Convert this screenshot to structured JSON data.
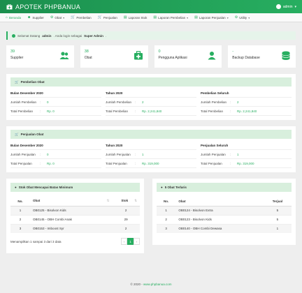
{
  "app": {
    "title": "APOTEK PHPBANUA",
    "user": "admin"
  },
  "nav": [
    {
      "icon": "home-icon",
      "glyph": "⌂",
      "label": "Beranda",
      "active": true,
      "caret": false
    },
    {
      "icon": "users-icon",
      "glyph": "☻",
      "label": "Supplier",
      "caret": false
    },
    {
      "icon": "gear-icon",
      "glyph": "⚙",
      "label": "Obat",
      "caret": true
    },
    {
      "icon": "cart-icon",
      "glyph": "🛒",
      "label": "Pembelian",
      "caret": false
    },
    {
      "icon": "cart-icon",
      "glyph": "🛒",
      "label": "Penjualan",
      "caret": false
    },
    {
      "icon": "file-icon",
      "glyph": "▤",
      "label": "Laporan Stok",
      "caret": false
    },
    {
      "icon": "file-icon",
      "glyph": "▤",
      "label": "Laporan Pembelian",
      "caret": true
    },
    {
      "icon": "file-icon",
      "glyph": "▤",
      "label": "Laporan Penjualan",
      "caret": true
    },
    {
      "icon": "gear-icon",
      "glyph": "⚙",
      "label": "Utility",
      "caret": true
    }
  ],
  "alert": {
    "prefix": "Selamat Datang",
    "user": "admin",
    "middle": ". Anda login sebagai",
    "role": "Super Admin",
    "suffix": "."
  },
  "stats": [
    {
      "value": "39",
      "label": "Supplier",
      "icon": "users-icon"
    },
    {
      "value": "38",
      "label": "Obat",
      "icon": "medkit-icon"
    },
    {
      "value": "0",
      "label": "Pengguna Aplikasi",
      "icon": "user-icon"
    },
    {
      "value": "-",
      "label": "Backup Database",
      "icon": "database-icon"
    }
  ],
  "pembelian": {
    "title": "Pembelian Obat",
    "cols": [
      {
        "head": "Bulan Desember 2020",
        "jumlah_label": "Jumlah Pembelian",
        "jumlah": "0",
        "total_label": "Total Pembelian",
        "total": "Rp. 0"
      },
      {
        "head": "Tahun 2020",
        "jumlah_label": "Jumlah Pembelian",
        "jumlah": "2",
        "total_label": "Total Pembelian",
        "total": "Rp. 2,241,840"
      },
      {
        "head": "Pembelian Seluruh",
        "jumlah_label": "Jumlah Pembelian",
        "jumlah": "2",
        "total_label": "Total Pembelian",
        "total": "Rp. 2,241,840"
      }
    ]
  },
  "penjualan": {
    "title": "Penjualan Obat",
    "cols": [
      {
        "head": "Bulan Desember 2020",
        "jumlah_label": "Jumlah Penjualan",
        "jumlah": "0",
        "total_label": "Total Penjualan",
        "total": "Rp. 0"
      },
      {
        "head": "Tahun 2020",
        "jumlah_label": "Jumlah Penjualan",
        "jumlah": "1",
        "total_label": "Total Penjualan",
        "total": "Rp. 319,000"
      },
      {
        "head": "Penjualan Seluruh",
        "jumlah_label": "Jumlah Penjualan",
        "jumlah": "1",
        "total_label": "Total Penjualan",
        "total": "Rp. 319,000"
      }
    ]
  },
  "stok": {
    "title": "Stok Obat Mencapai Batas Minimum",
    "headers": [
      "No.",
      "Obat",
      "Stok"
    ],
    "rows": [
      [
        "1",
        "OB0125 - Bisolvon Kids",
        "2"
      ],
      [
        "2",
        "OB0145 - OBH Combi Anak",
        "29"
      ],
      [
        "3",
        "OB0153 - Imboost Syr",
        "2"
      ]
    ],
    "info": "Menampilkan 1 sampai 3 dari 3 data",
    "pager": [
      "‹",
      "1",
      "›"
    ]
  },
  "terlaris": {
    "title": "5 Obat Terlaris",
    "headers": [
      "No.",
      "Obat",
      "Terjual"
    ],
    "rows": [
      [
        "1",
        "OB0124 - Bisolvon Extra",
        "5"
      ],
      [
        "2",
        "OB0123 - Bisolvon Kids",
        "5"
      ],
      [
        "3",
        "OB0140 - OBH Combi Dewasa",
        "1"
      ]
    ]
  },
  "footer": {
    "text": "© 2020 -",
    "link": "www.phpbanua.com"
  },
  "colors": {
    "brand": "#27ae60",
    "brand_dark": "#1b8f4e",
    "panel_head": "#d8efdd"
  }
}
